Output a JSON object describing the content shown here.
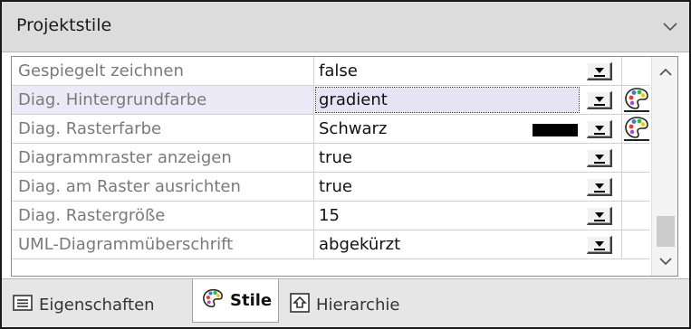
{
  "panel": {
    "title": "Projektstile"
  },
  "properties": [
    {
      "name": "Gespiegelt zeichnen",
      "value": "false",
      "has_swatch": false,
      "has_palette": false,
      "selected": false
    },
    {
      "name": "Diag. Hintergrundfarbe",
      "value": "gradient",
      "has_swatch": false,
      "has_palette": true,
      "selected": true
    },
    {
      "name": "Diag. Rasterfarbe",
      "value": "Schwarz",
      "has_swatch": true,
      "swatch_color": "#000000",
      "has_palette": true,
      "selected": false
    },
    {
      "name": "Diagrammraster anzeigen",
      "value": "true",
      "has_swatch": false,
      "has_palette": false,
      "selected": false
    },
    {
      "name": "Diag. am Raster ausrichten",
      "value": "true",
      "has_swatch": false,
      "has_palette": false,
      "selected": false
    },
    {
      "name": "Diag. Rastergröße",
      "value": "15",
      "has_swatch": false,
      "has_palette": false,
      "selected": false
    },
    {
      "name": "UML-Diagrammüberschrift",
      "value": "abgekürzt",
      "has_swatch": false,
      "has_palette": false,
      "selected": false
    }
  ],
  "tabs": [
    {
      "label": "Eigenschaften",
      "icon": "properties-list-icon",
      "active": false
    },
    {
      "label": "Stile",
      "icon": "palette-icon",
      "active": true
    },
    {
      "label": "Hierarchie",
      "icon": "hierarchy-icon",
      "active": false
    }
  ],
  "colors": {
    "header_bg": "#dcdcdc",
    "selected_row_bg": "#eceaf6",
    "property_name_text": "#7a7a7a",
    "tab_bar_bg": "#e6e6e6"
  }
}
